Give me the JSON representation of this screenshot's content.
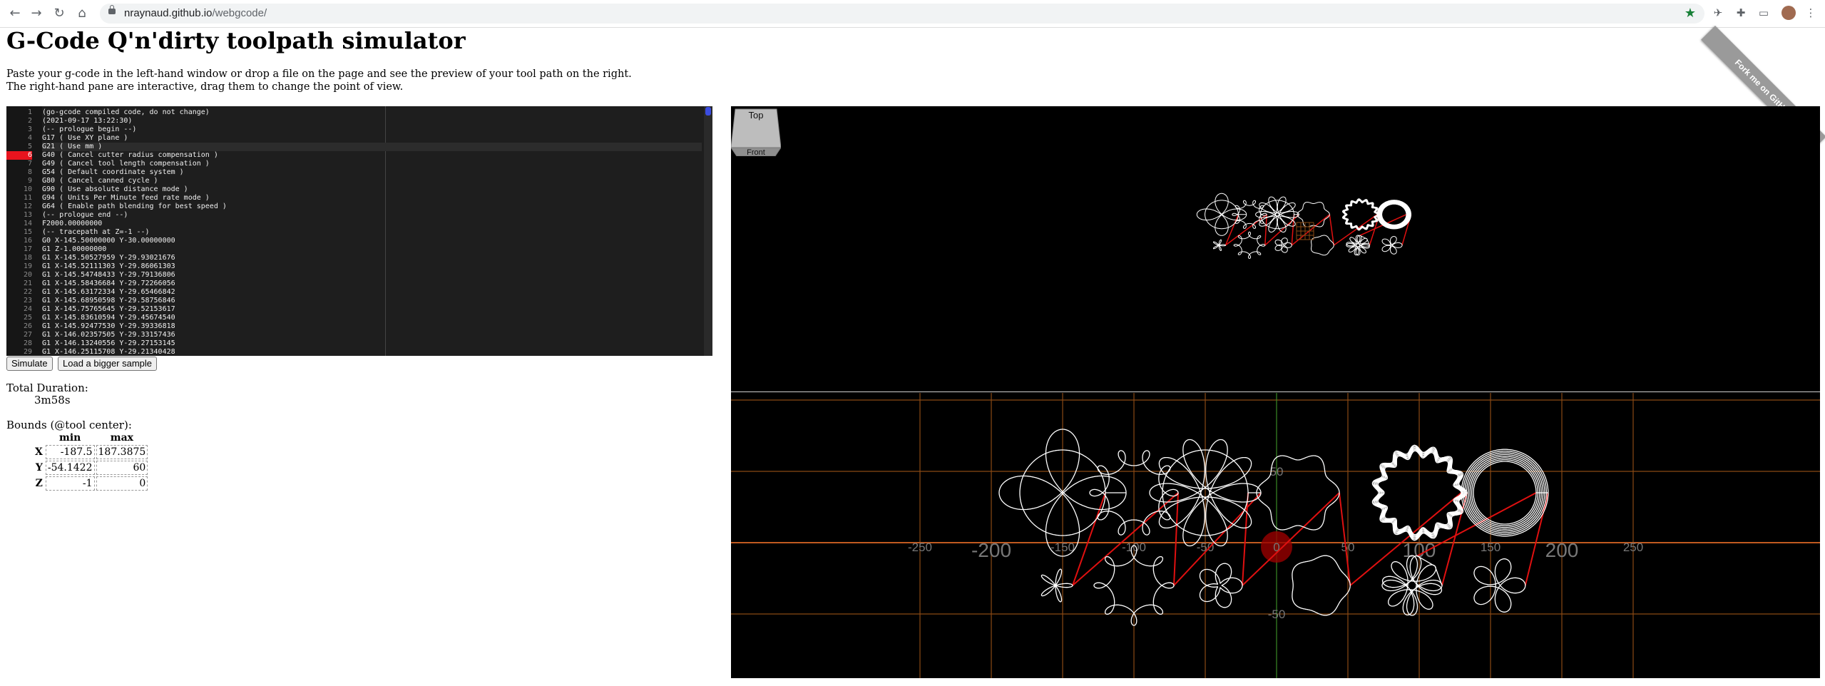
{
  "browser": {
    "url_host": "nraynaud.github.io",
    "url_path": "/webgcode/",
    "icons": [
      "back-icon",
      "forward-icon",
      "reload-icon",
      "home-icon",
      "lock-icon",
      "star-icon",
      "extension-icon",
      "puzzle-icon",
      "cast-icon",
      "avatar",
      "menu-icon"
    ]
  },
  "page": {
    "title": "G-Code Q'n'dirty toolpath simulator",
    "intro_line1": "Paste your g-code in the left-hand window or drop a file on the page and see the preview of your tool path on the right.",
    "intro_line2": "The right-hand pane are interactive, drag them to change the point of view.",
    "fork_ribbon": "Fork me on GitHub"
  },
  "editor": {
    "active_line": 5,
    "error_line": 6,
    "lines": [
      "(go-gcode compiled code, do not change)",
      "(2021-09-17 13:22:30)",
      "(-- prologue begin --)",
      "G17 ( Use XY plane )",
      "G21 ( Use mm )",
      "G40 ( Cancel cutter radius compensation )",
      "G49 ( Cancel tool length compensation )",
      "G54 ( Default coordinate system )",
      "G80 ( Cancel canned cycle )",
      "G90 ( Use absolute distance mode )",
      "G94 ( Units Per Minute feed rate mode )",
      "G64 ( Enable path blending for best speed )",
      "(-- prologue end --)",
      "F2000.00000000",
      "(-- tracepath at Z=-1 --)",
      "G0 X-145.50000000 Y-30.00000000",
      "G1 Z-1.00000000",
      "G1 X-145.50527959 Y-29.93021676",
      "G1 X-145.52111303 Y-29.86061303",
      "G1 X-145.54748433 Y-29.79136806",
      "G1 X-145.58436684 Y-29.72266056",
      "G1 X-145.63172334 Y-29.65466842",
      "G1 X-145.68950598 Y-29.58756846",
      "G1 X-145.75765645 Y-29.52153617",
      "G1 X-145.83610594 Y-29.45674540",
      "G1 X-145.92477530 Y-29.39336818",
      "G1 X-146.02357505 Y-29.33157436",
      "G1 X-146.13240556 Y-29.27153145",
      "G1 X-146.25115708 Y-29.21340428"
    ]
  },
  "buttons": {
    "simulate": "Simulate",
    "load_sample": "Load a bigger sample"
  },
  "stats": {
    "duration_label": "Total Duration:",
    "duration_value": "3m58s",
    "bounds_label": "Bounds (@tool center):",
    "col_min": "min",
    "col_max": "max",
    "rows": [
      {
        "axis": "X",
        "min": "-187.5",
        "max": "187.3875"
      },
      {
        "axis": "Y",
        "min": "-54.1422",
        "max": "60"
      },
      {
        "axis": "Z",
        "min": "-1",
        "max": "0"
      }
    ]
  },
  "viewer": {
    "cube_top": "Top",
    "cube_front": "Front",
    "x_ticks": [
      "-250",
      "-200",
      "-150",
      "-100",
      "-50",
      "0",
      "50",
      "100",
      "150",
      "200",
      "250"
    ],
    "y_ticks": [
      "50",
      "-50"
    ],
    "colors": {
      "path": "#ffffff",
      "rapid": "#e01010",
      "grid": "#8a4a14",
      "axis_x": "#c05a20",
      "axis_y": "#2a9a2a"
    }
  }
}
